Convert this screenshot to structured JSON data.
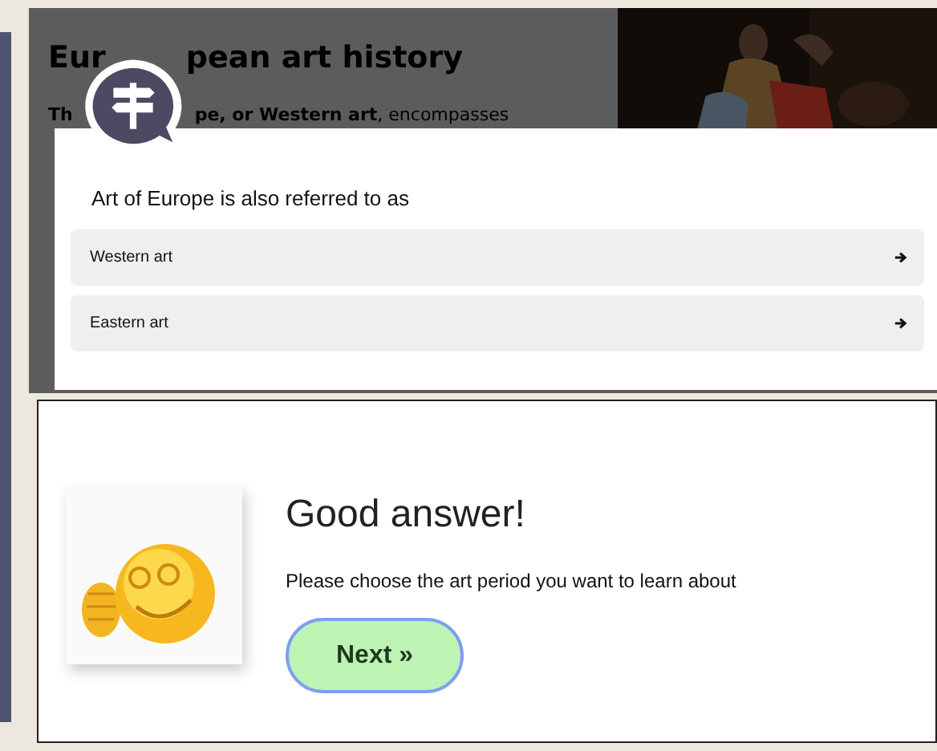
{
  "background_page": {
    "heading": [
      "Eur",
      "pean art history"
    ],
    "intro": [
      "Th",
      "**pe, or Western art**, encompasses"
    ]
  },
  "question": {
    "prompt": "Art of Europe is also referred to as",
    "options": [
      {
        "label": "Western art"
      },
      {
        "label": "Eastern art"
      }
    ]
  },
  "feedback": {
    "title": "Good answer!",
    "message": "Please choose the art period you want to learn about",
    "button": "Next »"
  }
}
